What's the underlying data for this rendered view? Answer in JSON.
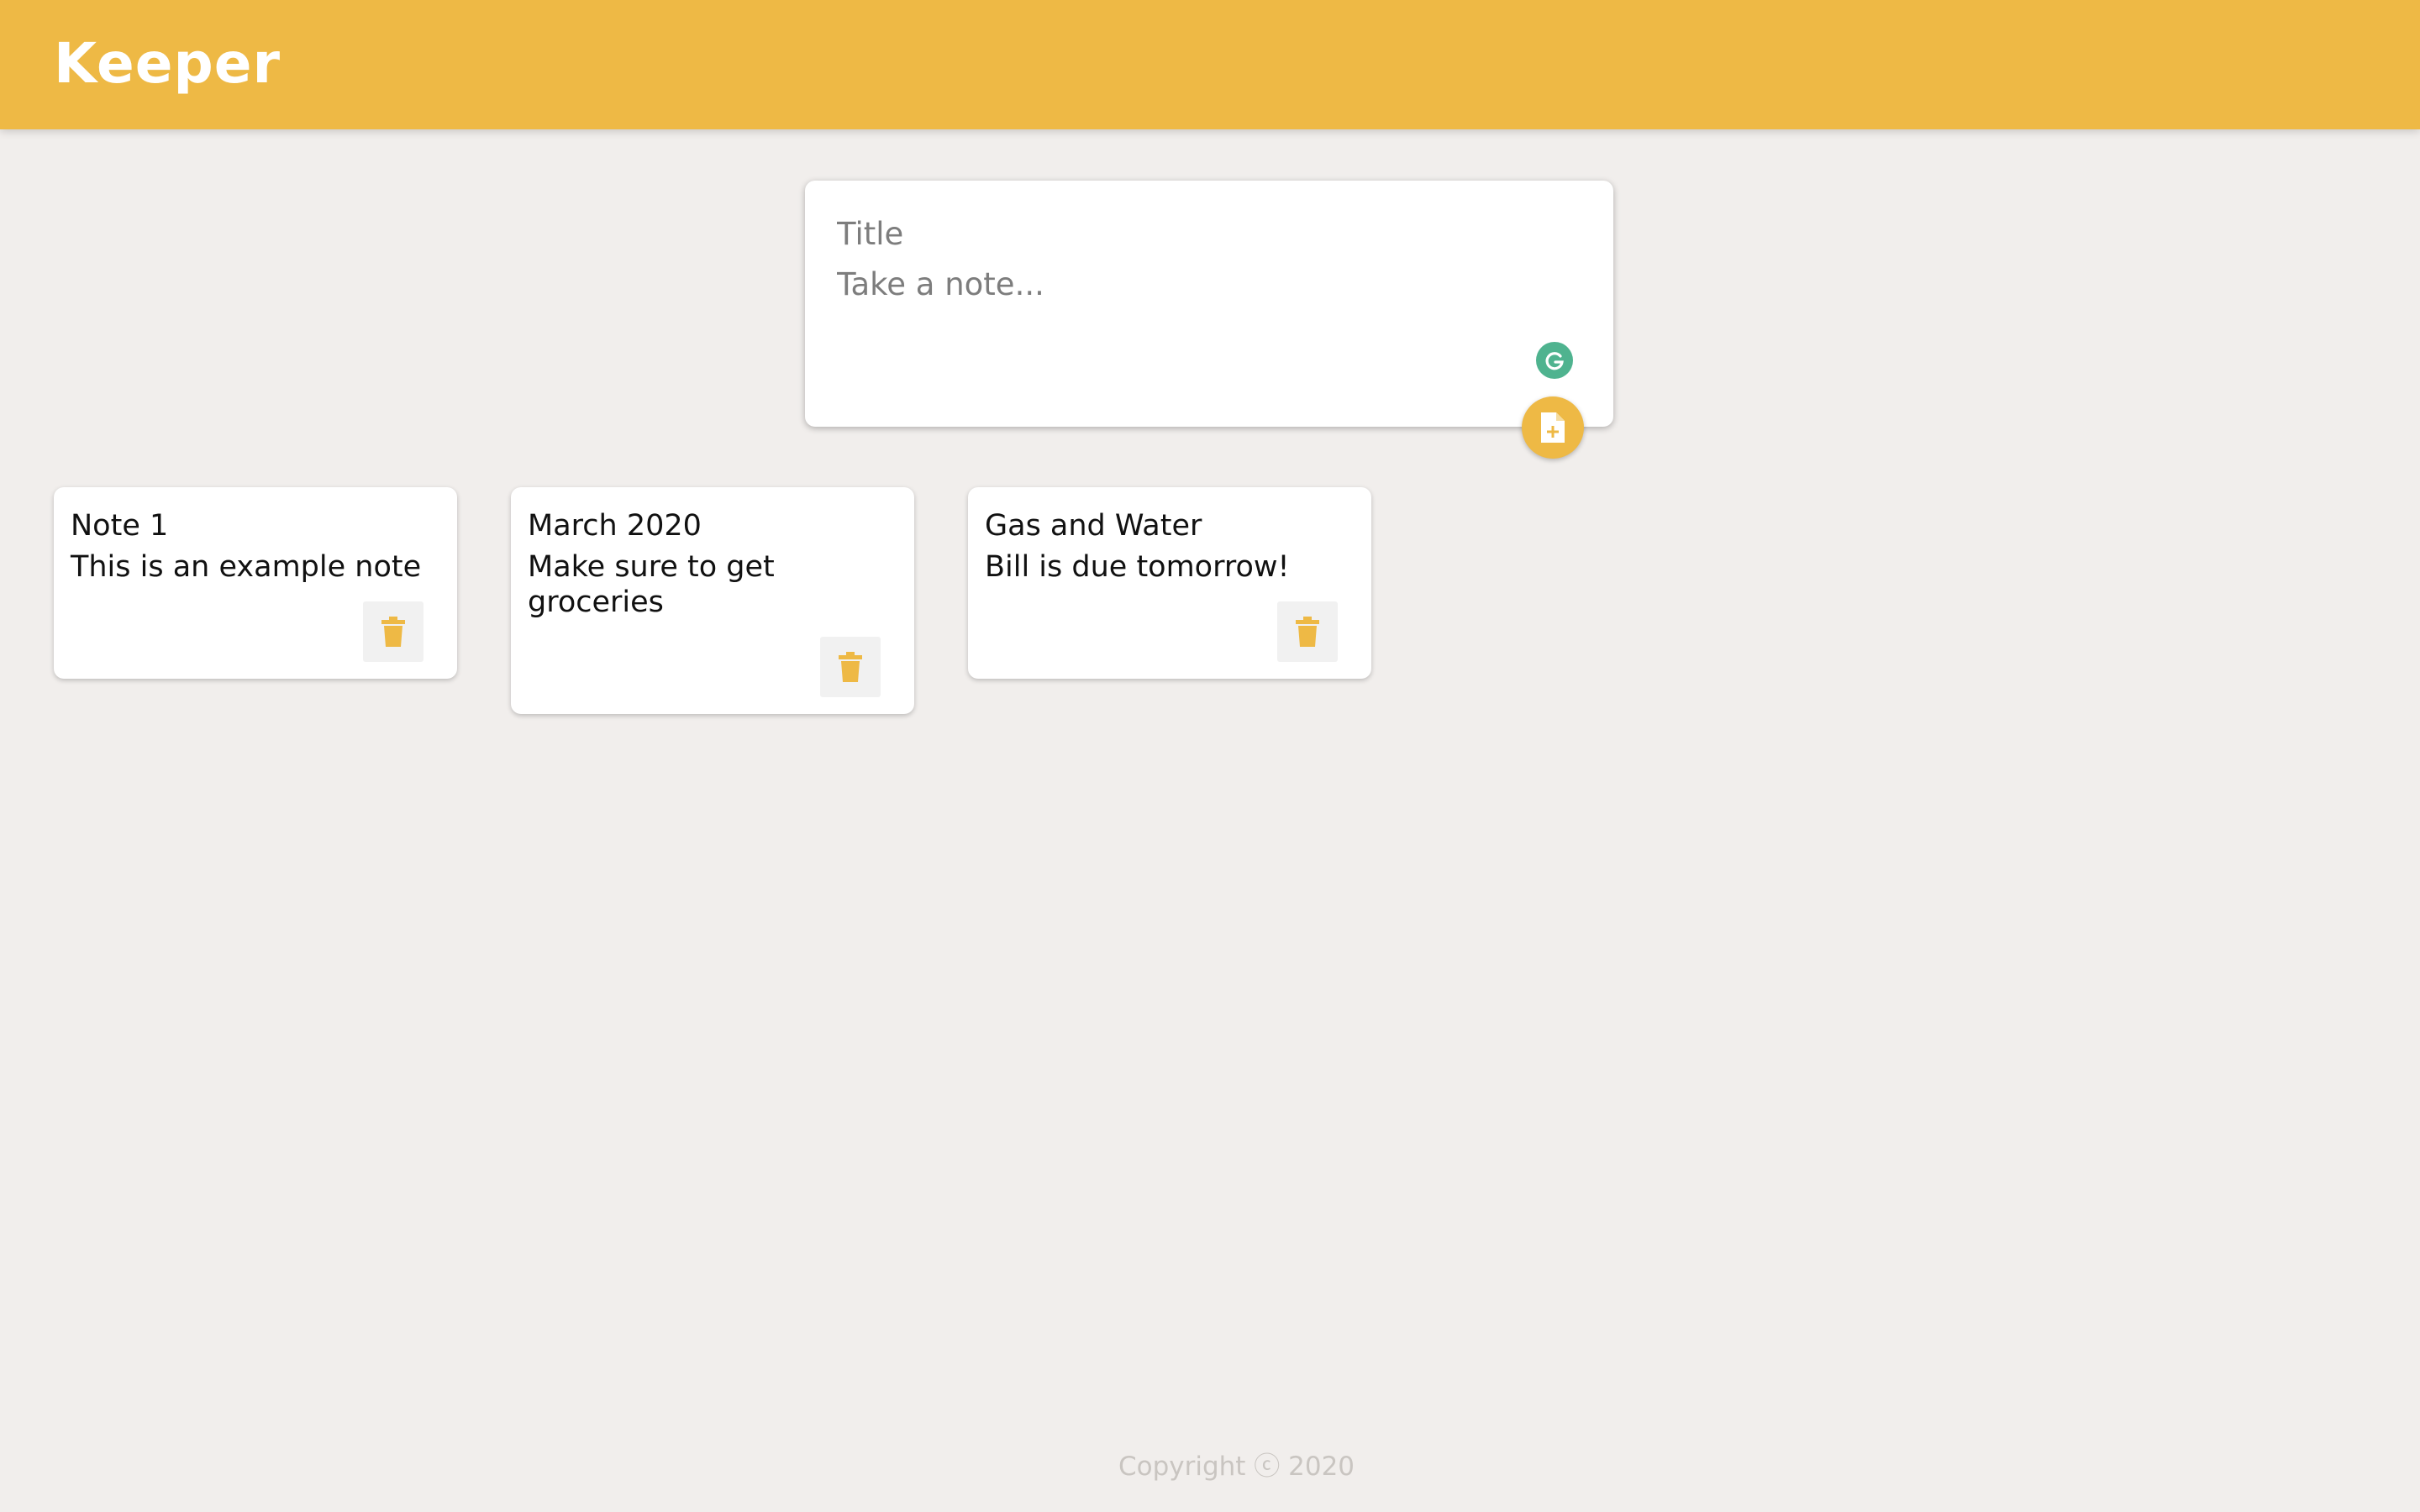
{
  "app": {
    "brand": "Keeper"
  },
  "composer": {
    "title_placeholder": "Title",
    "content_placeholder": "Take a note...",
    "add_icon": "note-add-icon",
    "assistant_icon": "grammarly-icon"
  },
  "notes": [
    {
      "title": "Note 1",
      "content": "This is an example note"
    },
    {
      "title": "March 2020",
      "content": "Make sure to get groceries"
    },
    {
      "title": "Gas and Water",
      "content": "Bill is due tomorrow!"
    }
  ],
  "footer": {
    "text": "Copyright ⓒ 2020"
  },
  "colors": {
    "accent": "#eeb945",
    "background": "#f1eeec",
    "card": "#ffffff",
    "grammarly": "#4fb38f"
  }
}
